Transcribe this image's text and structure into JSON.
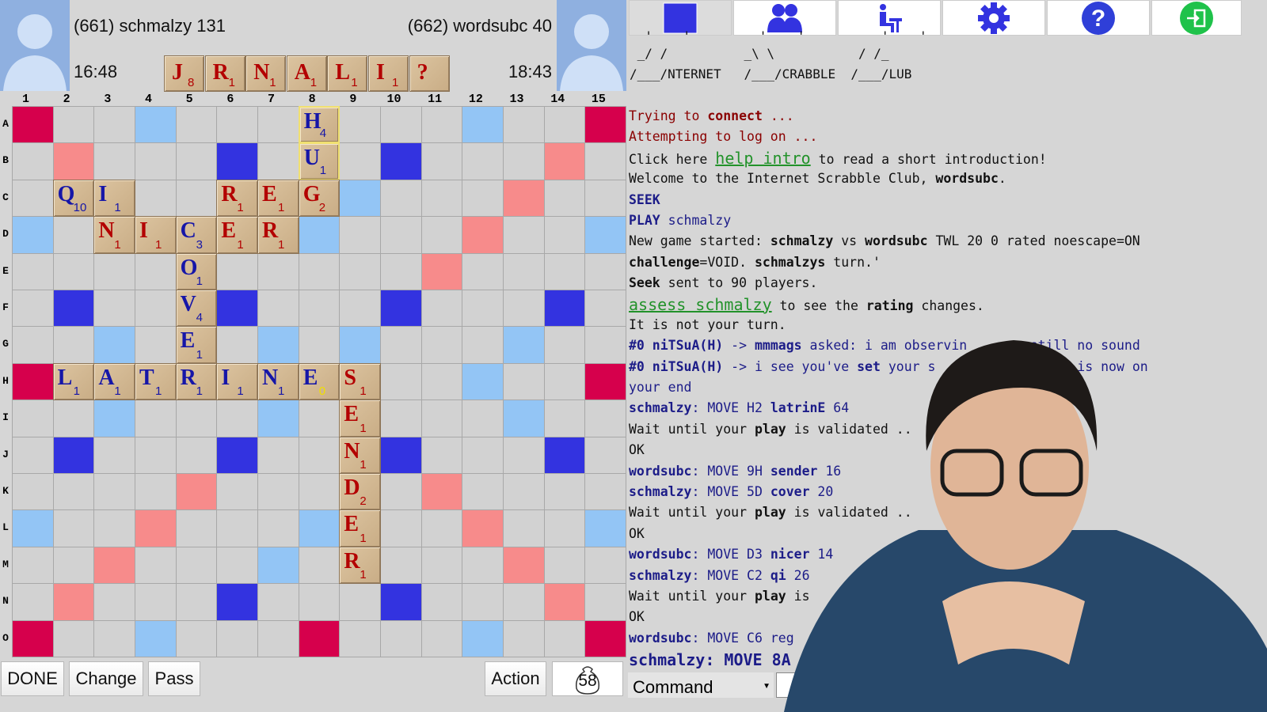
{
  "players": {
    "left": {
      "label": "(661) schmalzy 131",
      "clock": "16:48"
    },
    "right": {
      "label": "(662) wordsubc 40",
      "clock": "18:43"
    }
  },
  "rack": [
    {
      "letter": "J",
      "value": "8"
    },
    {
      "letter": "R",
      "value": "1"
    },
    {
      "letter": "N",
      "value": "1"
    },
    {
      "letter": "A",
      "value": "1"
    },
    {
      "letter": "L",
      "value": "1"
    },
    {
      "letter": "I",
      "value": "1"
    },
    {
      "letter": "?",
      "value": ""
    }
  ],
  "board": {
    "columns": [
      "1",
      "2",
      "3",
      "4",
      "5",
      "6",
      "7",
      "8",
      "9",
      "10",
      "11",
      "12",
      "13",
      "14",
      "15"
    ],
    "rows": [
      "A",
      "B",
      "C",
      "D",
      "E",
      "F",
      "G",
      "H",
      "I",
      "J",
      "K",
      "L",
      "M",
      "N",
      "O"
    ],
    "premium_legend": {
      "T": "triple-word",
      "D": "double-word",
      "t": "triple-letter",
      "d": "double-letter",
      ".": "plain"
    },
    "premium": [
      "T..d...T...d..T",
      ".D...t...t...D.",
      "..D...d.d...D..",
      "d..D...d...D..d",
      "....D.....D....",
      ".t...t...t...t.",
      "..d...d.d...d..",
      "T..d...D...d..T",
      "..d...d.d...d..",
      ".t...t...t...t.",
      "....D.....D....",
      "d..D...d...D..d",
      "..D...d.d...D..",
      ".D...t...t...D.",
      "T..d...T...d..T"
    ],
    "colors": {
      "T": "#d6004c",
      "D": "#f78b8b",
      "t": "#3333e0",
      "d": "#93c5f5",
      "tile_blue": "#1616a8",
      "tile_red": "#b30000"
    },
    "tiles": [
      {
        "row": 0,
        "col": 7,
        "letter": "H",
        "value": "4",
        "owner": "blue",
        "last": true
      },
      {
        "row": 1,
        "col": 7,
        "letter": "U",
        "value": "1",
        "owner": "blue",
        "last": true
      },
      {
        "row": 2,
        "col": 1,
        "letter": "Q",
        "value": "10",
        "owner": "blue"
      },
      {
        "row": 2,
        "col": 2,
        "letter": "I",
        "value": "1",
        "owner": "blue"
      },
      {
        "row": 2,
        "col": 5,
        "letter": "R",
        "value": "1",
        "owner": "red"
      },
      {
        "row": 2,
        "col": 6,
        "letter": "E",
        "value": "1",
        "owner": "red"
      },
      {
        "row": 2,
        "col": 7,
        "letter": "G",
        "value": "2",
        "owner": "red"
      },
      {
        "row": 3,
        "col": 2,
        "letter": "N",
        "value": "1",
        "owner": "red"
      },
      {
        "row": 3,
        "col": 3,
        "letter": "I",
        "value": "1",
        "owner": "red"
      },
      {
        "row": 3,
        "col": 4,
        "letter": "C",
        "value": "3",
        "owner": "blue"
      },
      {
        "row": 3,
        "col": 5,
        "letter": "E",
        "value": "1",
        "owner": "red"
      },
      {
        "row": 3,
        "col": 6,
        "letter": "R",
        "value": "1",
        "owner": "red"
      },
      {
        "row": 4,
        "col": 4,
        "letter": "O",
        "value": "1",
        "owner": "blue"
      },
      {
        "row": 5,
        "col": 4,
        "letter": "V",
        "value": "4",
        "owner": "blue"
      },
      {
        "row": 6,
        "col": 4,
        "letter": "E",
        "value": "1",
        "owner": "blue"
      },
      {
        "row": 7,
        "col": 1,
        "letter": "L",
        "value": "1",
        "owner": "blue"
      },
      {
        "row": 7,
        "col": 2,
        "letter": "A",
        "value": "1",
        "owner": "blue"
      },
      {
        "row": 7,
        "col": 3,
        "letter": "T",
        "value": "1",
        "owner": "blue"
      },
      {
        "row": 7,
        "col": 4,
        "letter": "R",
        "value": "1",
        "owner": "blue"
      },
      {
        "row": 7,
        "col": 5,
        "letter": "I",
        "value": "1",
        "owner": "blue"
      },
      {
        "row": 7,
        "col": 6,
        "letter": "N",
        "value": "1",
        "owner": "blue"
      },
      {
        "row": 7,
        "col": 7,
        "letter": "E",
        "value": "0",
        "owner": "blue",
        "blank": true
      },
      {
        "row": 7,
        "col": 8,
        "letter": "S",
        "value": "1",
        "owner": "red"
      },
      {
        "row": 8,
        "col": 8,
        "letter": "E",
        "value": "1",
        "owner": "red"
      },
      {
        "row": 9,
        "col": 8,
        "letter": "N",
        "value": "1",
        "owner": "red"
      },
      {
        "row": 10,
        "col": 8,
        "letter": "D",
        "value": "2",
        "owner": "red"
      },
      {
        "row": 11,
        "col": 8,
        "letter": "E",
        "value": "1",
        "owner": "red"
      },
      {
        "row": 12,
        "col": 8,
        "letter": "R",
        "value": "1",
        "owner": "red"
      }
    ]
  },
  "buttons": {
    "done": "DONE",
    "change": "Change",
    "pass": "Pass",
    "action": "Action",
    "bag_count": "58"
  },
  "toolbar": [
    "console-window-icon",
    "players-icon",
    "seek-seat-icon",
    "settings-gear-icon",
    "help-icon",
    "logout-icon"
  ],
  "ascii_art": [
    "  '   _'         '  __'          '  __'",
    " _/ /          _\\ \\           / /_",
    "/___/NTERNET   /___/CRABBLE  /___/LUB"
  ],
  "chat": [
    [
      {
        "t": "Trying to ",
        "c": "sys"
      },
      {
        "t": "connect",
        "c": "sys",
        "b": true
      },
      {
        "t": " ...",
        "c": "sys"
      }
    ],
    [
      {
        "t": "Attempting to log on ...",
        "c": "sys"
      }
    ],
    [
      {
        "t": "Click here ",
        "c": "norm"
      },
      {
        "t": "help intro",
        "c": "lnk"
      },
      {
        "t": " to read a short introduction!",
        "c": "norm"
      }
    ],
    [
      {
        "t": "Welcome to the Internet Scrabble Club, ",
        "c": "norm"
      },
      {
        "t": "wordsubc",
        "c": "norm",
        "b": true
      },
      {
        "t": ".",
        "c": "norm"
      }
    ],
    [
      {
        "t": "SEEK",
        "c": "blu",
        "b": true
      }
    ],
    [
      {
        "t": "PLAY",
        "c": "blu",
        "b": true
      },
      {
        "t": " schmalzy",
        "c": "blu"
      }
    ],
    [
      {
        "t": "New game started: ",
        "c": "norm"
      },
      {
        "t": "schmalzy",
        "c": "norm",
        "b": true
      },
      {
        "t": " vs ",
        "c": "norm"
      },
      {
        "t": "wordsubc",
        "c": "norm",
        "b": true
      },
      {
        "t": " TWL 20 0 rated noescape=ON",
        "c": "norm"
      }
    ],
    [
      {
        "t": "challenge",
        "c": "norm",
        "b": true
      },
      {
        "t": "=VOID. ",
        "c": "norm"
      },
      {
        "t": "schmalzys",
        "c": "norm",
        "b": true
      },
      {
        "t": " turn.'",
        "c": "norm"
      }
    ],
    [
      {
        "t": "Seek",
        "c": "norm",
        "b": true
      },
      {
        "t": " sent to 90 players.",
        "c": "norm"
      }
    ],
    [
      {
        "t": "assess schmalzy",
        "c": "lnk"
      },
      {
        "t": " to see the ",
        "c": "norm"
      },
      {
        "t": "rating",
        "c": "norm",
        "b": true
      },
      {
        "t": " changes.",
        "c": "norm"
      }
    ],
    [
      {
        "t": "It is not your turn.",
        "c": "norm"
      }
    ],
    [
      {
        "t": "#0 niTSuA(H)",
        "c": "blu",
        "b": true
      },
      {
        "t": " -> ",
        "c": "blu"
      },
      {
        "t": "mmmags",
        "c": "blu",
        "b": true
      },
      {
        "t": " asked: i am observin",
        "c": "blu"
      },
      {
        "t": "        still no sound",
        "c": "blu"
      }
    ],
    [
      {
        "t": "#0 niTSuA(H)",
        "c": "blu",
        "b": true
      },
      {
        "t": " -> i see you've ",
        "c": "blu"
      },
      {
        "t": "set",
        "c": "blu",
        "b": true
      },
      {
        "t": " your s",
        "c": "blu"
      },
      {
        "t": "          problem is now on",
        "c": "blu"
      }
    ],
    [
      {
        "t": "your end",
        "c": "blu"
      }
    ],
    [
      {
        "t": "schmalzy",
        "c": "blu",
        "b": true
      },
      {
        "t": ": MOVE H2 ",
        "c": "blu"
      },
      {
        "t": "latrinE",
        "c": "blu",
        "b": true
      },
      {
        "t": " 64",
        "c": "blu"
      }
    ],
    [
      {
        "t": "Wait until your ",
        "c": "norm"
      },
      {
        "t": "play",
        "c": "norm",
        "b": true
      },
      {
        "t": " is validated ..",
        "c": "norm"
      }
    ],
    [
      {
        "t": "OK",
        "c": "norm"
      }
    ],
    [
      {
        "t": "wordsubc",
        "c": "blu",
        "b": true
      },
      {
        "t": ": MOVE 9H ",
        "c": "blu"
      },
      {
        "t": "sender",
        "c": "blu",
        "b": true
      },
      {
        "t": " 16",
        "c": "blu"
      }
    ],
    [
      {
        "t": "schmalzy",
        "c": "blu",
        "b": true
      },
      {
        "t": ": MOVE 5D ",
        "c": "blu"
      },
      {
        "t": "cover",
        "c": "blu",
        "b": true
      },
      {
        "t": " 20",
        "c": "blu"
      }
    ],
    [
      {
        "t": "Wait until your ",
        "c": "norm"
      },
      {
        "t": "play",
        "c": "norm",
        "b": true
      },
      {
        "t": " is validated ..",
        "c": "norm"
      }
    ],
    [
      {
        "t": "OK",
        "c": "norm"
      }
    ],
    [
      {
        "t": "wordsubc",
        "c": "blu",
        "b": true
      },
      {
        "t": ": MOVE D3 ",
        "c": "blu"
      },
      {
        "t": "nicer",
        "c": "blu",
        "b": true
      },
      {
        "t": " 14",
        "c": "blu"
      }
    ],
    [
      {
        "t": "schmalzy",
        "c": "blu",
        "b": true
      },
      {
        "t": ": MOVE C2 ",
        "c": "blu"
      },
      {
        "t": "qi",
        "c": "blu",
        "b": true
      },
      {
        "t": " 26",
        "c": "blu"
      }
    ],
    [
      {
        "t": "Wait until your ",
        "c": "norm"
      },
      {
        "t": "play",
        "c": "norm",
        "b": true
      },
      {
        "t": " is",
        "c": "norm"
      }
    ],
    [
      {
        "t": "OK",
        "c": "norm"
      }
    ],
    [
      {
        "t": "wordsubc",
        "c": "blu",
        "b": true
      },
      {
        "t": ": MOVE C6 reg",
        "c": "blu"
      }
    ]
  ],
  "chat_last": "schmalzy: MOVE 8A",
  "command": {
    "selected": "Command",
    "value": ""
  }
}
